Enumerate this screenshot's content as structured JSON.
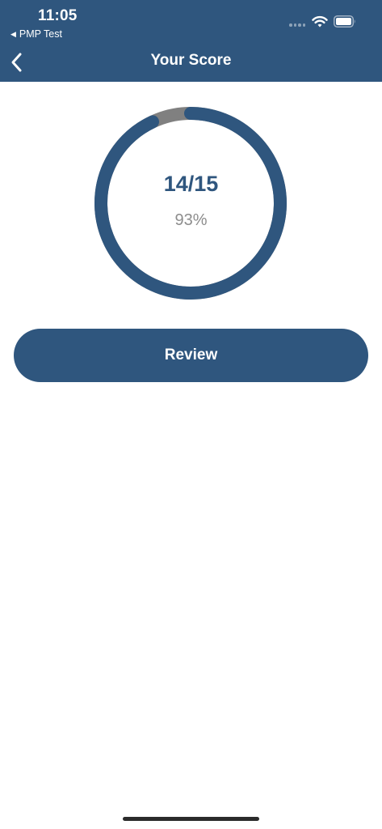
{
  "status_bar": {
    "time": "11:05",
    "back_app_label": "PMP Test",
    "icons": [
      "signal-dots-icon",
      "wifi-icon",
      "battery-icon"
    ]
  },
  "nav": {
    "title": "Your Score",
    "back_icon": "chevron-left-icon"
  },
  "score": {
    "fraction": "14/15",
    "percent": "93%",
    "ring_progress": 0.93
  },
  "review_button": {
    "label": "Review"
  },
  "colors": {
    "primary": "#2f567e",
    "ring_remainder": "#808080",
    "percent_text": "#8d8d8d",
    "background": "#ffffff"
  }
}
